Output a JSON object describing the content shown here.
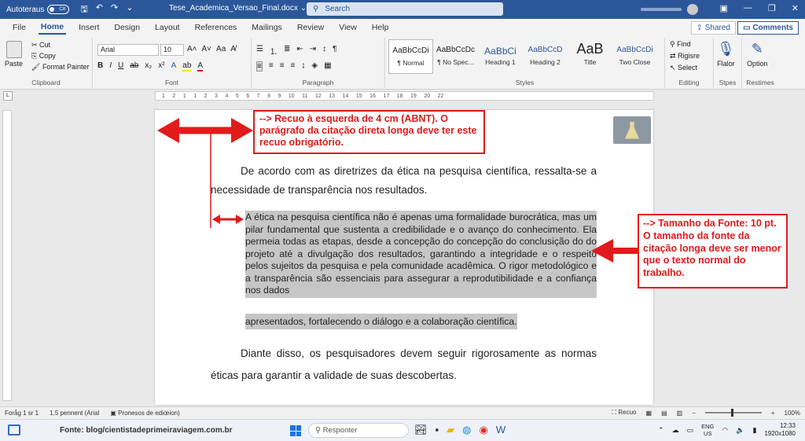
{
  "titlebar": {
    "autosave_label": "Autoteraus",
    "autosave_state": "C8",
    "doc_title": "Tese_Academica_Versao_Final.docx ⌄",
    "search_placeholder": "Search"
  },
  "menu": {
    "tabs": [
      "File",
      "Home",
      "Insert",
      "Design",
      "Layout",
      "References",
      "Mailings",
      "Review",
      "View",
      "Help"
    ],
    "shared_label": "Shared",
    "comments_label": "Comments"
  },
  "ribbon": {
    "clipboard": {
      "paste": "Paste",
      "cut": "Cut",
      "copy": "Copy",
      "format_painter": "Format Painter",
      "label": "Clipboard"
    },
    "font": {
      "name": "Arial",
      "size": "10",
      "label": "Font"
    },
    "paragraph": {
      "label": "Paragraph"
    },
    "styles": {
      "items": [
        {
          "sample": "AaBbCcDi",
          "name": "¶ Normal"
        },
        {
          "sample": "AaBbCcDc",
          "name": "¶ No Spec..."
        },
        {
          "sample": "AaBbCi",
          "name": "Heading 1"
        },
        {
          "sample": "AaBbCcD",
          "name": "Heading 2"
        },
        {
          "sample": "AaB",
          "name": "Title"
        },
        {
          "sample": "AaBbCcDi",
          "name": "Two Close"
        }
      ],
      "label": "Styles"
    },
    "editing": {
      "find": "Find",
      "replace": "Rigisre",
      "select": "Select",
      "label": "Editing"
    },
    "voice": {
      "name": "Flalor",
      "label": "Stpes"
    },
    "options": {
      "name": "Option",
      "label": "Restimes"
    }
  },
  "ruler": {
    "marks": [
      "1",
      "2",
      "1",
      "1",
      "2",
      "3",
      "4",
      "5",
      "6",
      "7",
      "8",
      "9",
      "10",
      "11",
      "12",
      "13",
      "14",
      "15",
      "16",
      "17",
      "18",
      "19",
      "20",
      "22"
    ]
  },
  "document": {
    "p1": "De acordo com as diretrizes da ética na pesquisa científica, ressalta-se a necessidade de transparência nos resultados.",
    "quote": "A ética na pesquisa científica não é apenas uma formalidade burocrática, mas um pilar fundamental que sustenta a credibilidade e o avanço do conhecimento. Ela permeia todas as etapas, desde a concepção do concepção do conclusição do do projeto até a divulgação dos resultados, garantindo a integridade e o respeito pelos sujeitos da pesquisa e pela comunidade acadêmica. O rigor metodológico e a transparência são essenciais para assegurar a reprodutibilidade e a confiança nos dados",
    "quote_last": "apresentados, fortalecendo o diálogo e a colaboração científica.",
    "p3": "Diante disso, os pesquisadores devem seguir rigorosamente as normas éticas para garantir a validade de suas descobertas."
  },
  "annotations": {
    "indent": "--> Recuo à esquerda de 4 cm (ABNT). O parágrafo da citação direta longa deve ter este recuo obrigatório.",
    "font_size": "--> Tamanho da Fonte: 10 pt. O tamanho da fonte da citação longa deve ser menor que o texto normal do trabalho.",
    "color": "#e11b1b"
  },
  "statusbar": {
    "page": "Foråg 1 sr 1",
    "words": "1,5 pennent (Arial",
    "proofing": "Pronesos de ediœion)",
    "focus": "Recuo",
    "zoom": "100%"
  },
  "taskbar": {
    "source": "Fonte: blog/cientistadeprimeiraviagem.com.br",
    "search": "Responter",
    "lang_top": "ENG",
    "lang_bottom": "US",
    "time": "12:33",
    "resolution": "1920x1080"
  },
  "colors": {
    "word_blue": "#2b579a",
    "highlight": "#c6c6c6"
  }
}
